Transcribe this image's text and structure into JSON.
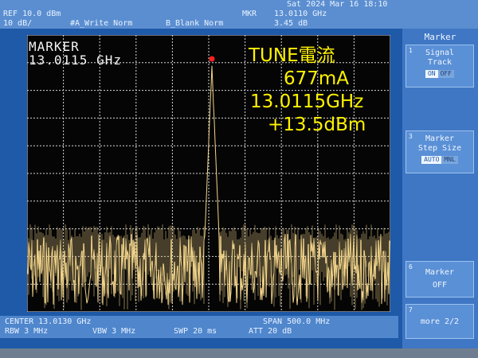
{
  "status": {
    "ref": "REF 10.0 dBm",
    "scale": "10 dB/",
    "trace_a": "#A_Write Norm",
    "trace_b": "B_Blank Norm",
    "datetime": "Sat 2024 Mar 16 18:10",
    "mkr_label": "MKR",
    "mkr_freq": "13.0110 GHz",
    "mkr_amp": "3.45 dB"
  },
  "marker_box": {
    "title": "MARKER",
    "value": "13.0115 GHz"
  },
  "annotation": {
    "line1": "TUNE電流",
    "line2": "677mA",
    "line3": "13.0115GHz",
    "line4": "+13.5dBm"
  },
  "bottom": {
    "center": "CENTER 13.0130 GHz",
    "span": "SPAN 500.0 MHz",
    "rbw": "RBW 3 MHz",
    "vbw": "VBW 3 MHz",
    "swp": "SWP 20 ms",
    "att": "ATT 20 dB"
  },
  "softkeys": {
    "k1_title": "Marker",
    "k1_num": "1",
    "k1_label_a": "Signal",
    "k1_label_b": "Track",
    "k1_on": "ON",
    "k1_off": "OFF",
    "k3_num": "3",
    "k3_label_a": "Marker",
    "k3_label_b": "Step Size",
    "k3_auto": "AUTO",
    "k3_mnl": "MNL",
    "k6_num": "6",
    "k6_label_a": "Marker",
    "k6_label_b": "OFF",
    "k7_num": "7",
    "k7_label": "more 2/2"
  },
  "colors": {
    "screen": "#1e5aa8",
    "trace": "#f2d48a",
    "annotation": "#fff200",
    "marker": "#ff2020"
  }
}
